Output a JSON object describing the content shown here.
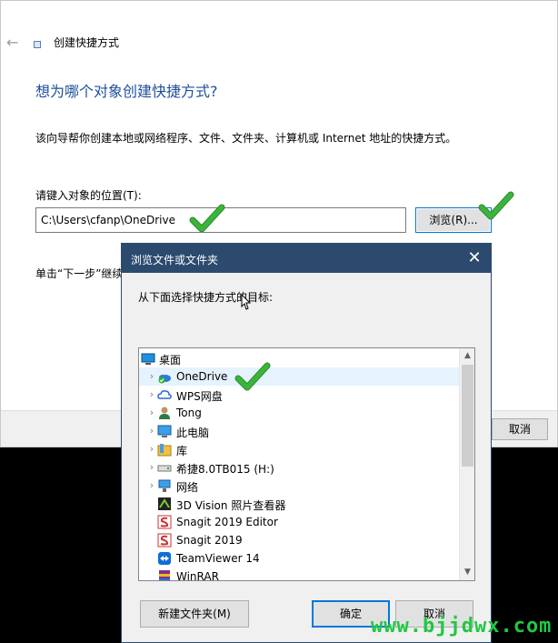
{
  "wizard": {
    "title": "创建快捷方式",
    "heading": "想为哪个对象创建快捷方式?",
    "description": "该向导帮你创建本地或网络程序、文件、文件夹、计算机或 Internet 地址的快捷方式。",
    "location_label": "请键入对象的位置(T):",
    "location_value": "C:\\Users\\cfanp\\OneDrive",
    "browse_label": "浏览(R)...",
    "next_note": "单击“下一步”继续",
    "cancel_label": "取消"
  },
  "dialog": {
    "title": "浏览文件或文件夹",
    "close_label": "✕",
    "prompt": "从下面选择快捷方式的目标:",
    "tree": [
      {
        "label": "桌面",
        "icon": "desktop-icon",
        "expandable": false,
        "indent": 0
      },
      {
        "label": "OneDrive",
        "icon": "onedrive-icon",
        "expandable": true,
        "indent": 1,
        "selected": true
      },
      {
        "label": "WPS网盘",
        "icon": "cloud-icon",
        "expandable": true,
        "indent": 1
      },
      {
        "label": "Tong",
        "icon": "user-icon",
        "expandable": true,
        "indent": 1
      },
      {
        "label": "此电脑",
        "icon": "computer-icon",
        "expandable": true,
        "indent": 1
      },
      {
        "label": "库",
        "icon": "library-icon",
        "expandable": true,
        "indent": 1
      },
      {
        "label": "希捷8.0TB015 (H:)",
        "icon": "drive-icon",
        "expandable": true,
        "indent": 1
      },
      {
        "label": "网络",
        "icon": "network-icon",
        "expandable": true,
        "indent": 1
      },
      {
        "label": "3D Vision 照片查看器",
        "icon": "app-3dvision-icon",
        "expandable": false,
        "indent": 1
      },
      {
        "label": "Snagit 2019 Editor",
        "icon": "app-snagit-icon",
        "expandable": false,
        "indent": 1
      },
      {
        "label": "Snagit 2019",
        "icon": "app-snagit-icon",
        "expandable": false,
        "indent": 1
      },
      {
        "label": "TeamViewer 14",
        "icon": "app-teamviewer-icon",
        "expandable": false,
        "indent": 1
      },
      {
        "label": "WinRAR",
        "icon": "app-winrar-icon",
        "expandable": false,
        "indent": 1
      }
    ],
    "new_folder_label": "新建文件夹(M)",
    "ok_label": "确定",
    "cancel_label": "取消"
  },
  "watermark": {
    "text": "www.bjjdwx.com",
    "small": "www.bjjdwx.com"
  },
  "colors": {
    "heading": "#1f4f9c",
    "dialog_titlebar": "#2b4a6e",
    "accent": "#0078d7",
    "checkmark": "#3cb43c",
    "watermark": "#22c744"
  }
}
